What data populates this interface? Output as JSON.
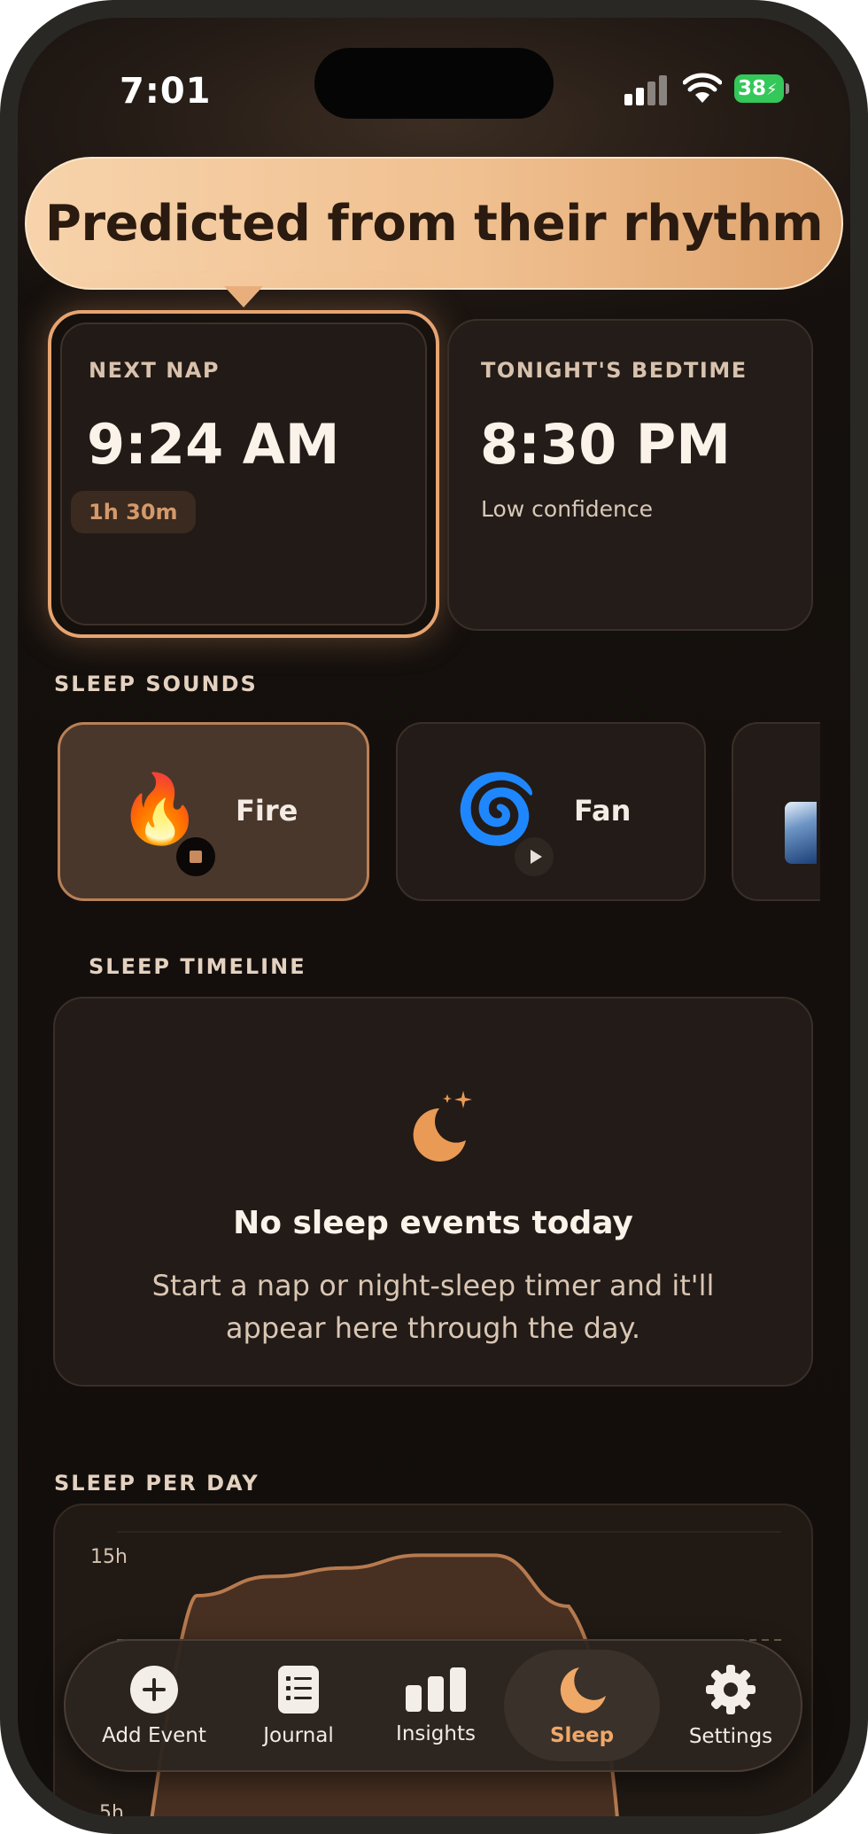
{
  "status_bar": {
    "time": "7:01",
    "battery": "38"
  },
  "tooltip": {
    "text": "Predicted from their rhythm"
  },
  "next_nap": {
    "label": "NEXT NAP",
    "time": "9:24 AM",
    "countdown": "1h 30m"
  },
  "bedtime": {
    "label": "TONIGHT'S BEDTIME",
    "time": "8:30 PM",
    "confidence": "Low confidence"
  },
  "sleep_sounds": {
    "title": "SLEEP SOUNDS",
    "items": [
      {
        "name": "Fire",
        "emoji": "🔥",
        "state": "playing"
      },
      {
        "name": "Fan",
        "emoji": "🌀",
        "state": "stopped"
      }
    ]
  },
  "timeline": {
    "title": "SLEEP TIMELINE",
    "empty_title": "No sleep events today",
    "empty_body_line1": "Start a nap or night-sleep timer and it'll",
    "empty_body_line2": "appear here through the day."
  },
  "sleep_per_day": {
    "title": "SLEEP PER DAY",
    "y_ticks": [
      "15h",
      "5h"
    ]
  },
  "chart_data": {
    "type": "area",
    "title": "",
    "y_ticks": [
      "15h",
      "5h"
    ],
    "series": [
      {
        "values": [
          12.0,
          12.9,
          13.3,
          13.9,
          13.9,
          11.5
        ]
      }
    ]
  },
  "tab_bar": {
    "tabs": [
      {
        "label": "Add Event",
        "icon": "plus-circle-icon"
      },
      {
        "label": "Journal",
        "icon": "journal-icon"
      },
      {
        "label": "Insights",
        "icon": "bar-chart-icon"
      },
      {
        "label": "Sleep",
        "icon": "moon-icon",
        "active": true
      },
      {
        "label": "Settings",
        "icon": "gear-icon"
      }
    ]
  },
  "colors": {
    "accent": "#f0a867",
    "card": "#221b17",
    "active_sound": "#4a372b"
  }
}
